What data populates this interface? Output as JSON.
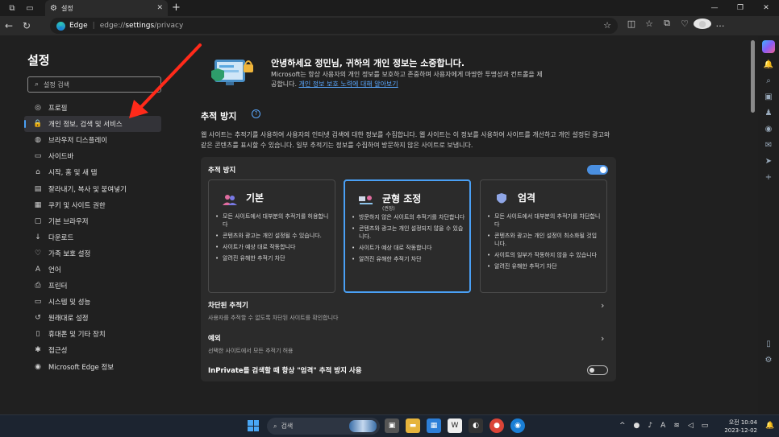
{
  "browser": {
    "tab_title": "설정",
    "url_brand": "Edge",
    "url_prefix": "edge://",
    "url_bold": "settings",
    "url_suffix": "/privacy"
  },
  "sidebar": {
    "title": "설정",
    "search_placeholder": "설정 검색",
    "items": [
      {
        "label": "프로필",
        "icon": "profile-icon"
      },
      {
        "label": "개인 정보, 검색 및 서비스",
        "icon": "lock-icon",
        "active": true
      },
      {
        "label": "브라우저 디스플레이",
        "icon": "palette-icon"
      },
      {
        "label": "사이드바",
        "icon": "sidebar-icon"
      },
      {
        "label": "시작, 홈 및 새 탭",
        "icon": "home-icon"
      },
      {
        "label": "잘라내기, 복사 및 붙여넣기",
        "icon": "clipboard-icon"
      },
      {
        "label": "쿠키 및 사이트 권한",
        "icon": "cookie-icon"
      },
      {
        "label": "기본 브라우저",
        "icon": "browser-icon"
      },
      {
        "label": "다운로드",
        "icon": "download-icon"
      },
      {
        "label": "가족 보호 설정",
        "icon": "family-icon"
      },
      {
        "label": "언어",
        "icon": "language-icon"
      },
      {
        "label": "프린터",
        "icon": "printer-icon"
      },
      {
        "label": "시스템 및 성능",
        "icon": "system-icon"
      },
      {
        "label": "원래대로 설정",
        "icon": "reset-icon"
      },
      {
        "label": "휴대폰 및 기타 장치",
        "icon": "phone-icon"
      },
      {
        "label": "접근성",
        "icon": "accessibility-icon"
      },
      {
        "label": "Microsoft Edge 정보",
        "icon": "edge-icon"
      }
    ]
  },
  "hero": {
    "title": "안녕하세요 정민님, 귀하의 개인 정보는 소중합니다.",
    "desc": "Microsoft는 항상 사용자의 개인 정보를 보호하고 존중하며 사용자에게 마땅한 투명성과 컨트롤을 제공합니다.",
    "link": "개인 정보 보호 노력에 대해 알아보기"
  },
  "tracking": {
    "title": "추적 방지",
    "help": "?",
    "desc": "웹 사이트는 추적기를 사용하여 사용자의 인터넷 검색에 대한 정보를 수집합니다. 웹 사이트는 이 정보를 사용하여 사이트를 개선하고 개인 설정된 광고와 같은 콘텐츠를 표시할 수 있습니다. 일부 추적기는 정보를 수집하여 방문하지 않은 사이트로 보냅니다.",
    "card_title": "추적 방지",
    "toggle_on": true,
    "options": [
      {
        "name": "기본",
        "sub": "",
        "bullets": [
          "모든 사이트에서 대부분의 추적기를 허용합니다",
          "콘텐츠와 광고는 개인 설정될 수 있습니다.",
          "사이트가 예상 대로 작동합니다",
          "알려진 유해한 추적기 차단"
        ]
      },
      {
        "name": "균형 조정",
        "sub": "(권장)",
        "selected": true,
        "bullets": [
          "방문하지 않은 사이트의 추적기를 차단합니다",
          "콘텐츠와 광고는 개인 설정되지 않을 수 있습니다.",
          "사이트가 예상 대로 작동합니다",
          "알려진 유해한 추적기 차단"
        ]
      },
      {
        "name": "엄격",
        "sub": "",
        "bullets": [
          "모든 사이트에서 대부분의 추적기를 차단합니다",
          "콘텐츠와 광고는 개인 설정이 최소화될 것입니다.",
          "사이트의 일부가 작동하지 않을 수 있습니다",
          "알려진 유해한 추적기 차단"
        ]
      }
    ],
    "blocked_title": "차단된 추적기",
    "blocked_sub": "사용자를 추적할 수 없도록 차단된 사이트를 확인합니다",
    "exceptions_title": "예외",
    "exceptions_sub": "선택한 사이트에서 모든 추적기 허용",
    "inprivate_title": "InPrivate를 검색할 때 항상 \"엄격\" 추적 방지 사용",
    "inprivate_on": false
  },
  "taskbar": {
    "search": "검색",
    "tray_lang": "A",
    "time": "오전 10:04",
    "date": "2023-12-02"
  },
  "colors": {
    "accent": "#4aa0f5",
    "annotation_arrow": "#ff2a1a"
  }
}
